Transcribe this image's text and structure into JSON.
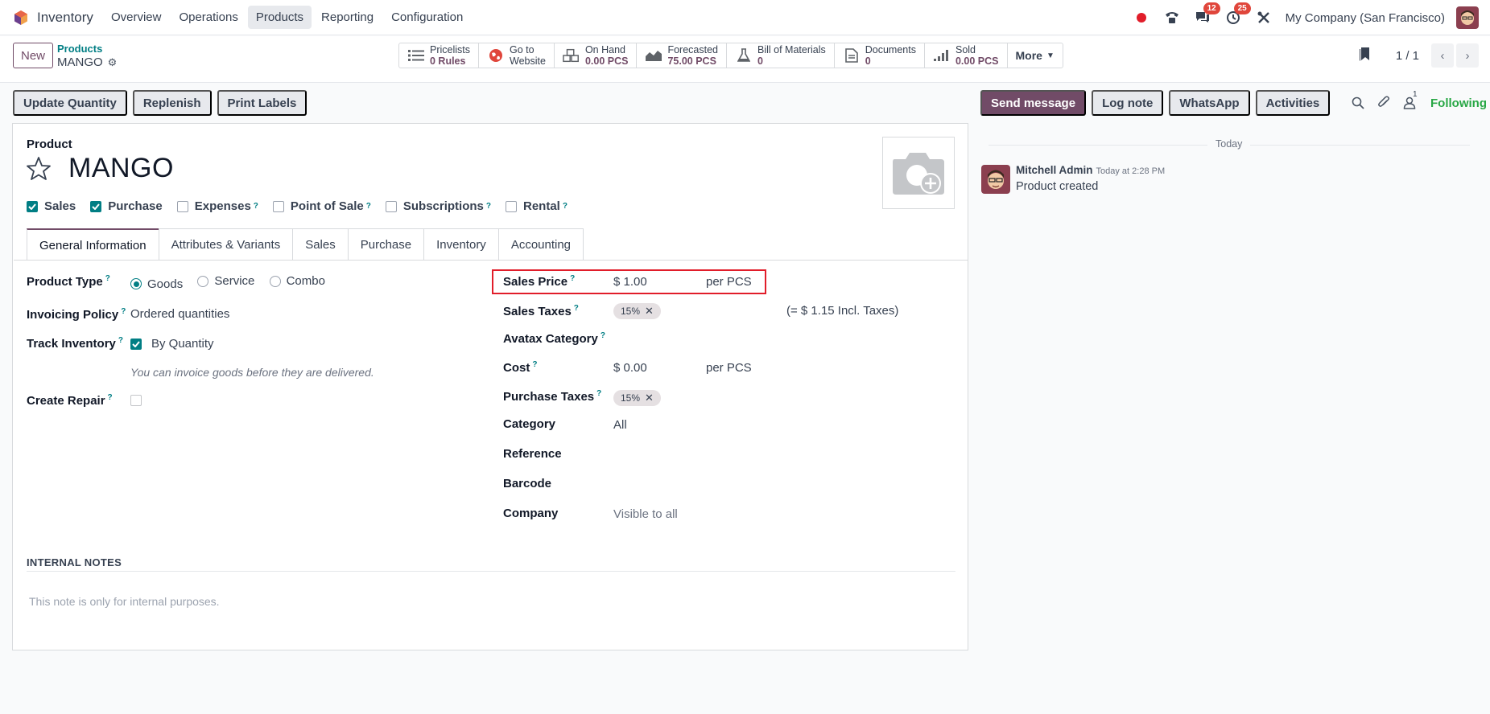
{
  "navbar": {
    "app_name": "Inventory",
    "menu": [
      "Overview",
      "Operations",
      "Products",
      "Reporting",
      "Configuration"
    ],
    "active_menu": "Products",
    "messages_badge": "12",
    "activities_badge": "25",
    "company": "My Company (San Francisco)"
  },
  "control_panel": {
    "new_label": "New",
    "breadcrumb": "Products",
    "record_name": "MANGO",
    "smart_buttons": [
      {
        "icon": "list-icon",
        "label": "Pricelists",
        "value": "0 Rules"
      },
      {
        "icon": "globe-icon",
        "label": "Go to",
        "value": "Website"
      },
      {
        "icon": "boxes-icon",
        "label": "On Hand",
        "value": "0.00 PCS"
      },
      {
        "icon": "area-chart-icon",
        "label": "Forecasted",
        "value": "75.00 PCS"
      },
      {
        "icon": "flask-icon",
        "label": "Bill of Materials",
        "value": "0"
      },
      {
        "icon": "document-icon",
        "label": "Documents",
        "value": "0"
      },
      {
        "icon": "signal-icon",
        "label": "Sold",
        "value": "0.00 PCS"
      }
    ],
    "more_label": "More",
    "pager": "1 / 1"
  },
  "actions": [
    "Update Quantity",
    "Replenish",
    "Print Labels"
  ],
  "form": {
    "section_label": "Product",
    "product_name": "MANGO",
    "checkboxes": [
      {
        "label": "Sales",
        "checked": true,
        "tooltip": false
      },
      {
        "label": "Purchase",
        "checked": true,
        "tooltip": false
      },
      {
        "label": "Expenses",
        "checked": false,
        "tooltip": true
      },
      {
        "label": "Point of Sale",
        "checked": false,
        "tooltip": true
      },
      {
        "label": "Subscriptions",
        "checked": false,
        "tooltip": true
      },
      {
        "label": "Rental",
        "checked": false,
        "tooltip": true
      }
    ],
    "tabs": [
      "General Information",
      "Attributes & Variants",
      "Sales",
      "Purchase",
      "Inventory",
      "Accounting"
    ],
    "active_tab": "General Information",
    "left": {
      "product_type_label": "Product Type",
      "product_type_options": [
        "Goods",
        "Service",
        "Combo"
      ],
      "product_type_selected": "Goods",
      "invoicing_policy_label": "Invoicing Policy",
      "invoicing_policy_value": "Ordered quantities",
      "track_inventory_label": "Track Inventory",
      "track_inventory_value": "By Quantity",
      "track_inventory_hint": "You can invoice goods before they are delivered.",
      "create_repair_label": "Create Repair"
    },
    "right": {
      "sales_price_label": "Sales Price",
      "sales_price_value": "$ 1.00",
      "sales_price_uom": "per PCS",
      "sales_taxes_label": "Sales Taxes",
      "sales_taxes_tag": "15%",
      "sales_taxes_incl": "(= $ 1.15 Incl. Taxes)",
      "avatax_label": "Avatax Category",
      "cost_label": "Cost",
      "cost_value": "$ 0.00",
      "cost_uom": "per PCS",
      "purchase_taxes_label": "Purchase Taxes",
      "purchase_taxes_tag": "15%",
      "category_label": "Category",
      "category_value": "All",
      "reference_label": "Reference",
      "barcode_label": "Barcode",
      "company_label": "Company",
      "company_placeholder": "Visible to all"
    },
    "notes_title": "INTERNAL NOTES",
    "notes_placeholder": "This note is only for internal purposes."
  },
  "chatter": {
    "send_message": "Send message",
    "log_note": "Log note",
    "whatsapp": "WhatsApp",
    "activities": "Activities",
    "followers_count": "1",
    "following": "Following",
    "day_separator": "Today",
    "message": {
      "author": "Mitchell Admin",
      "time": "Today at 2:28 PM",
      "body": "Product created"
    }
  },
  "colors": {
    "primary": "#714b67",
    "accent": "#017e84",
    "highlight": "#e11d2a",
    "following": "#28a745"
  }
}
